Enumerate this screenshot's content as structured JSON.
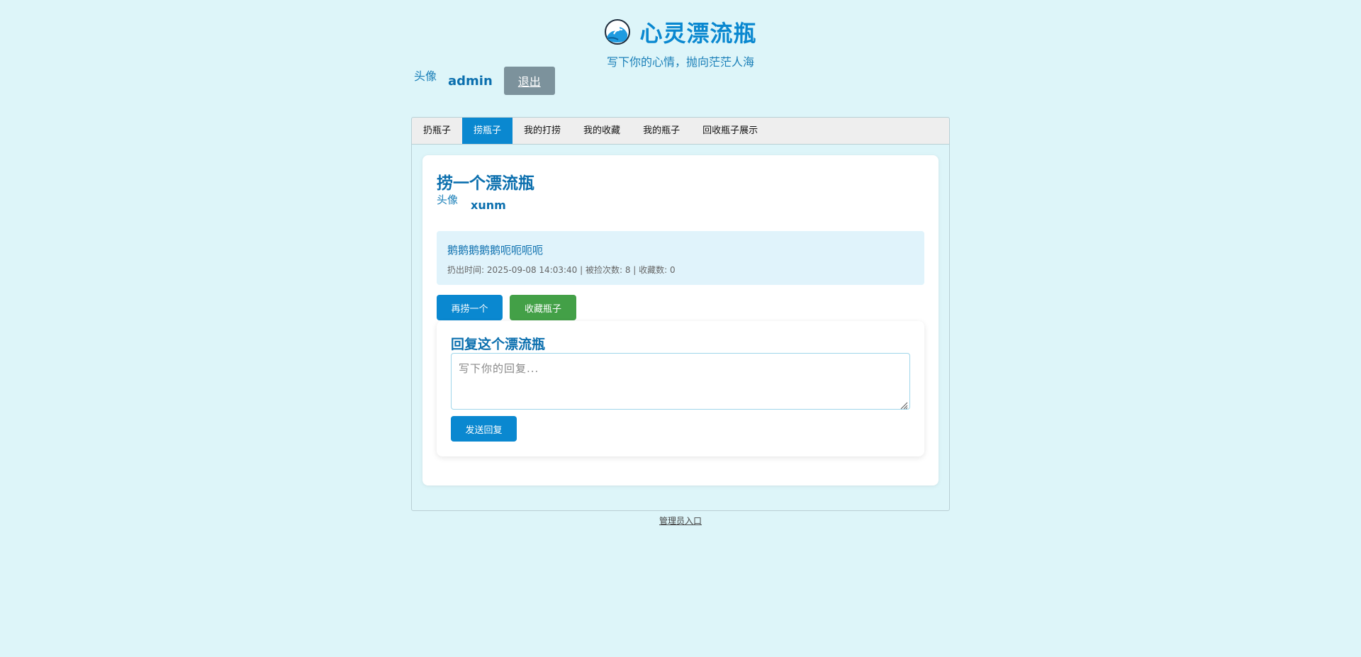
{
  "header": {
    "logo_icon": "wave-icon",
    "title": "心灵漂流瓶",
    "subtitle": "写下你的心情，抛向茫茫人海"
  },
  "user": {
    "avatar_alt": "头像",
    "name": "admin",
    "logout_label": "退出"
  },
  "tabs": [
    {
      "label": "扔瓶子",
      "active": false
    },
    {
      "label": "捞瓶子",
      "active": true
    },
    {
      "label": "我的打捞",
      "active": false
    },
    {
      "label": "我的收藏",
      "active": false
    },
    {
      "label": "我的瓶子",
      "active": false
    },
    {
      "label": "回收瓶子展示",
      "active": false
    }
  ],
  "catch": {
    "title": "捞一个漂流瓶",
    "sender_avatar_alt": "头像",
    "sender_name": "xunm",
    "message": "鹅鹅鹅鹅鹅呃呃呃呃",
    "meta": "扔出时间: 2025-09-08 14:03:40 | 被捡次数: 8 | 收藏数: 0",
    "again_label": "再捞一个",
    "favorite_label": "收藏瓶子"
  },
  "reply": {
    "title": "回复这个漂流瓶",
    "placeholder": "写下你的回复...",
    "send_label": "发送回复"
  },
  "footer": {
    "admin_link": "管理员入口"
  },
  "colors": {
    "background": "#ddf5f9",
    "accent": "#0a88d0",
    "green": "#43a047",
    "logout": "#7c929c"
  }
}
